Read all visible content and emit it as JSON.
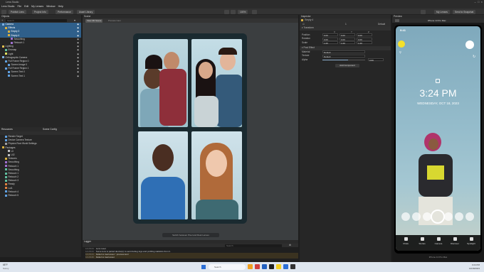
{
  "window": {
    "title": "Lens Studio"
  },
  "menu": [
    "Lens Studio",
    "File",
    "Edit",
    "My Lenses",
    "Window",
    "Help"
  ],
  "toolbar": {
    "publish": "Publish Lens",
    "project_info": "Project Info",
    "performance": "Performance",
    "asset_library": "Asset Library",
    "zoom": "100%",
    "my_lenses": "My Lenses",
    "send_to_snapchat": "Send to Snapchat"
  },
  "objects_panel": {
    "title": "Objects",
    "search_placeholder": "Search",
    "rows": [
      {
        "label": "Camera",
        "sel": true
      },
      {
        "label": "Effects",
        "sel": true
      },
      {
        "label": "Empty 3",
        "sel": true
      },
      {
        "label": "Empty 4",
        "sel": true
      },
      {
        "label": "Smoothing",
        "sel": false
      },
      {
        "label": "Retouch 1",
        "sel": false
      },
      {
        "label": "Lighting",
        "sel": false
      },
      {
        "label": "Envmap",
        "sel": false
      },
      {
        "label": "Light",
        "sel": false
      },
      {
        "label": "Orthographic Camera",
        "sel": false
      },
      {
        "label": "Full Frame Region 0",
        "sel": false
      },
      {
        "label": "Screen Image 0",
        "sel": false
      },
      {
        "label": "Full Frame Region 1",
        "sel": false
      },
      {
        "label": "Screen Text 0",
        "sel": false
      },
      {
        "label": "Screen Text 1",
        "sel": false
      }
    ]
  },
  "resources_panel": {
    "tabs": [
      "Resources",
      "Scene Config"
    ],
    "rows": [
      "Render Target",
      "Device Camera Texture",
      "Physics Root World Settings",
      "Packages",
      "UI",
      "UI2",
      "Textures",
      "Smoothing",
      "Retouch 1",
      "Smoothing",
      "Retouch 1",
      "Retouch 2",
      "Retouch 3",
      "Ready",
      "Lut1",
      "Retouch 4",
      "Retouch 5"
    ]
  },
  "scene_panel": {
    "title": "Scene",
    "tabs": [
      "View 3D Scene",
      "Preview Cam"
    ],
    "footer": "Switch between Pixel and Real Lenses"
  },
  "console": {
    "title": "Logger",
    "search_placeholder": "Search",
    "lines": [
      {
        "time": "12:29:24",
        "text": "Lens reset"
      },
      {
        "time": "12:29:24",
        "text": "Some lens is paired device(s) to send debug logs and profiling statistics from it."
      },
      {
        "time": "12:29:24",
        "text": "Failed to load asset: '.preview-lens'"
      },
      {
        "time": "12:29:29",
        "text": "Failed to load asset"
      }
    ]
  },
  "inspector": {
    "title": "Inspector",
    "object_name": "Empty 4",
    "layer": "1",
    "default": "Default",
    "transform_title": "Transform",
    "position": [
      "0.00",
      "0.00",
      "0.00"
    ],
    "rotation": [
      "0.00",
      "0.00",
      "0.00"
    ],
    "scale": [
      "1.00",
      "1.00",
      "1.00"
    ],
    "labels": {
      "position": "Position",
      "rotation": "Rotation",
      "scale": "Scale"
    },
    "post_effect_title": "Post Effect",
    "material_label": "Material",
    "material_value": "Default",
    "texture_label": "Texture",
    "texture_value": "Default",
    "alpha_label": "Alpha",
    "alpha_value": "0.60",
    "add_component": "Add Component"
  },
  "preview": {
    "title": "Preview",
    "device": "iPhone 13 Pro Max",
    "status_time": "9:41",
    "lock_time": "3:24 PM",
    "lock_date": "WEDNESDAY, OCT 18, 2023",
    "bottom_nav": [
      "Chats",
      "Stories",
      "Camera",
      "Discover",
      "Spotlight"
    ],
    "status_bottom": "iPhone 13 Pro Max"
  },
  "taskbar": {
    "weather": "68°F",
    "weather_sub": "Sunny",
    "search_placeholder": "Search",
    "time": "3:24 PM",
    "date": "10/18/2023"
  },
  "colors": {
    "accent": "#2f5f8a",
    "bg": "#262626",
    "phone_sky": "#8fb6c4"
  }
}
